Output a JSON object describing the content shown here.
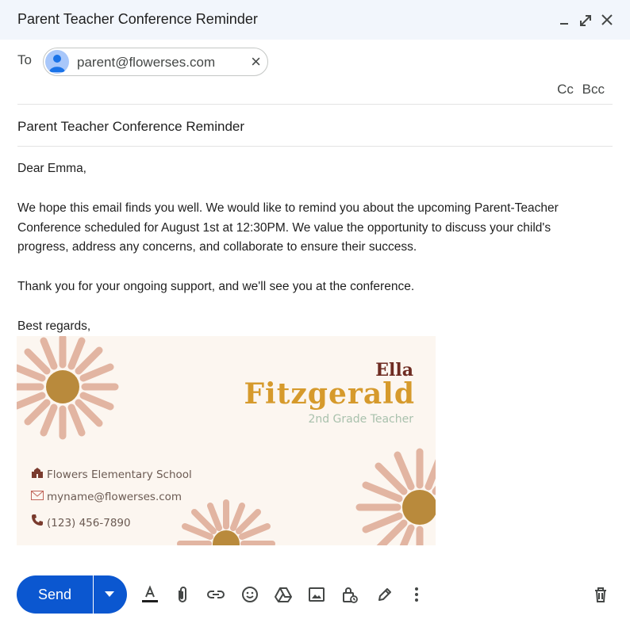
{
  "window": {
    "title": "Parent Teacher Conference Reminder",
    "minimize_icon": "minimize-icon",
    "expand_icon": "expand-icon",
    "close_icon": "close-icon"
  },
  "recipients": {
    "to_label": "To",
    "to_chip": "parent@flowerses.com",
    "cc_label": "Cc",
    "bcc_label": "Bcc"
  },
  "subject": "Parent Teacher Conference Reminder",
  "body": {
    "greeting": "Dear Emma,",
    "paragraph1": "We hope this email finds you well. We would like to remind you about the upcoming Parent-Teacher Conference scheduled for August 1st at 12:30PM. We value the opportunity to discuss your child's progress, address any concerns, and collaborate to ensure their success.",
    "paragraph2": "Thank you for your ongoing support, and we'll see you at the conference.",
    "closing": "Best regards,"
  },
  "signature": {
    "first_name": "Ella",
    "last_name": "Fitzgerald",
    "role": "2nd Grade Teacher",
    "school": "Flowers Elementary School",
    "email": "myname@flowerses.com",
    "phone": "(123) 456-7890",
    "colors": {
      "background": "#fcf6f0",
      "first_name": "#6e2c22",
      "last_name": "#d69a2c",
      "role": "#a9c1ad",
      "petal": "#e2b5a2",
      "flower_center": "#b98a3c"
    }
  },
  "toolbar": {
    "send_label": "Send",
    "accent": "#0b57d0",
    "icons": [
      "text-format-icon",
      "attach-icon",
      "link-icon",
      "emoji-icon",
      "drive-icon",
      "image-icon",
      "confidential-lock-icon",
      "signature-pen-icon",
      "more-options-icon",
      "delete-icon"
    ]
  }
}
